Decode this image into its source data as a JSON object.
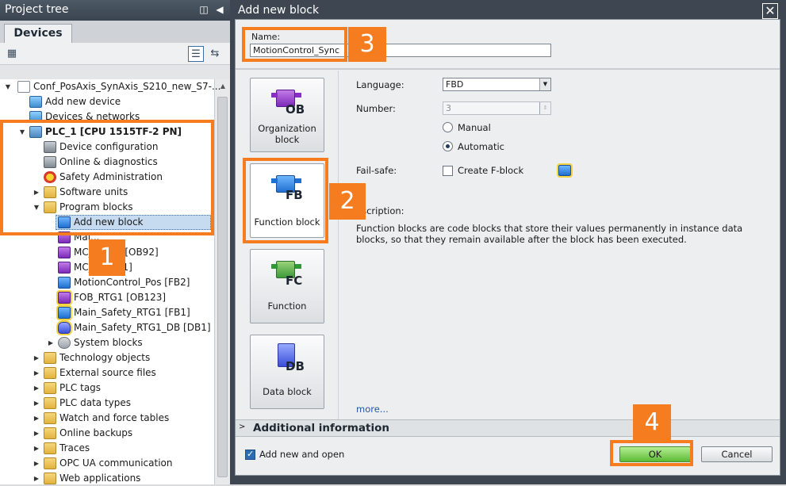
{
  "project_tree": {
    "title": "Project tree",
    "header_icons": [
      "panel-toggle-icon",
      "collapse-left-icon"
    ],
    "tab": "Devices",
    "items": [
      {
        "label": "Conf_PosAxis_SynAxis_S210_new_S7-...",
        "level": 0,
        "twisty": "expanded",
        "icon": "document-icon"
      },
      {
        "label": "Add new device",
        "level": 1,
        "twisty": "none",
        "icon": "add-device-icon"
      },
      {
        "label": "Devices & networks",
        "level": 1,
        "twisty": "none",
        "icon": "network-icon"
      },
      {
        "label": "PLC_1 [CPU 1515TF-2 PN]",
        "level": 1,
        "twisty": "expanded",
        "icon": "cpu-icon",
        "bold": true
      },
      {
        "label": "Device configuration",
        "level": 2,
        "twisty": "none",
        "icon": "device-config-icon"
      },
      {
        "label": "Online & diagnostics",
        "level": 2,
        "twisty": "none",
        "icon": "diagnostics-icon"
      },
      {
        "label": "Safety Administration",
        "level": 2,
        "twisty": "none",
        "icon": "safety-icon"
      },
      {
        "label": "Software units",
        "level": 2,
        "twisty": "collapsed",
        "icon": "folder-icon"
      },
      {
        "label": "Program blocks",
        "level": 2,
        "twisty": "expanded",
        "icon": "folder-icon"
      },
      {
        "label": "Add new block",
        "level": 3,
        "twisty": "none",
        "icon": "add-block-icon",
        "selected": true
      },
      {
        "label": "Mai...",
        "level": 3,
        "twisty": "none",
        "icon": "ob-block-icon"
      },
      {
        "label": "MC_...ator [OB92]",
        "level": 3,
        "twisty": "none",
        "icon": "ob-block-icon"
      },
      {
        "label": "MC_...OB91]",
        "level": 3,
        "twisty": "none",
        "icon": "ob-block-icon"
      },
      {
        "label": "MotionControl_Pos [FB2]",
        "level": 3,
        "twisty": "none",
        "icon": "fb-block-icon"
      },
      {
        "label": "FOB_RTG1 [OB123]",
        "level": 3,
        "twisty": "none",
        "icon": "ob-safety-block-icon"
      },
      {
        "label": "Main_Safety_RTG1 [FB1]",
        "level": 3,
        "twisty": "none",
        "icon": "fb-safety-block-icon"
      },
      {
        "label": "Main_Safety_RTG1_DB [DB1]",
        "level": 3,
        "twisty": "none",
        "icon": "db-safety-block-icon"
      },
      {
        "label": "System blocks",
        "level": 3,
        "twisty": "collapsed",
        "icon": "gear-icon"
      },
      {
        "label": "Technology objects",
        "level": 2,
        "twisty": "collapsed",
        "icon": "folder-icon"
      },
      {
        "label": "External source files",
        "level": 2,
        "twisty": "collapsed",
        "icon": "folder-icon"
      },
      {
        "label": "PLC tags",
        "level": 2,
        "twisty": "collapsed",
        "icon": "folder-icon"
      },
      {
        "label": "PLC data types",
        "level": 2,
        "twisty": "collapsed",
        "icon": "folder-icon"
      },
      {
        "label": "Watch and force tables",
        "level": 2,
        "twisty": "collapsed",
        "icon": "folder-icon"
      },
      {
        "label": "Online backups",
        "level": 2,
        "twisty": "collapsed",
        "icon": "folder-icon"
      },
      {
        "label": "Traces",
        "level": 2,
        "twisty": "collapsed",
        "icon": "folder-icon"
      },
      {
        "label": "OPC UA communication",
        "level": 2,
        "twisty": "collapsed",
        "icon": "folder-icon"
      },
      {
        "label": "Web applications",
        "level": 2,
        "twisty": "collapsed",
        "icon": "folder-icon"
      }
    ]
  },
  "dialog": {
    "title": "Add new block",
    "name_label": "Name:",
    "name_value": "MotionControl_Sync",
    "block_types": [
      {
        "code": "OB",
        "label": "Organization block",
        "icon": "organization-block-icon",
        "color": "#8a2fc4"
      },
      {
        "code": "FB",
        "label": "Function block",
        "icon": "function-block-icon",
        "color": "#1f6fd0",
        "active": true
      },
      {
        "code": "FC",
        "label": "Function",
        "icon": "function-icon",
        "color": "#2f9a35"
      },
      {
        "code": "DB",
        "label": "Data block",
        "icon": "data-block-icon",
        "color": "#3a4ed8"
      }
    ],
    "language_label": "Language:",
    "language_value": "FBD",
    "number_label": "Number:",
    "number_value": "3",
    "radio_manual": "Manual",
    "radio_automatic": "Automatic",
    "selected_numbering": "Automatic",
    "failsafe_label": "Fail-safe:",
    "create_fblock_label": "Create F-block",
    "create_fblock_checked": false,
    "description_label": "escription:",
    "description_text": "Function blocks are code blocks that store their values permanently in instance data blocks, so that they remain available after the block has been executed.",
    "more_link": "more...",
    "additional_info": "Additional information",
    "add_new_and_open": "Add new and open",
    "add_new_and_open_checked": true,
    "ok_label": "OK",
    "cancel_label": "Cancel"
  },
  "callouts": [
    "1",
    "2",
    "3",
    "4"
  ],
  "colors": {
    "callout": "#f57c1f",
    "ok_button": "#5bbb35",
    "dialog_frame": "#3d4651"
  }
}
